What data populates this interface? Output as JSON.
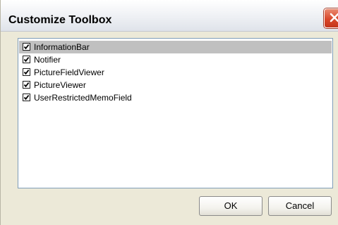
{
  "window": {
    "title": "Customize Toolbox"
  },
  "list": {
    "items": [
      {
        "label": "InformationBar",
        "checked": true,
        "selected": true
      },
      {
        "label": "Notifier",
        "checked": true,
        "selected": false
      },
      {
        "label": "PictureFieldViewer",
        "checked": true,
        "selected": false
      },
      {
        "label": "PictureViewer",
        "checked": true,
        "selected": false
      },
      {
        "label": "UserRestrictedMemoField",
        "checked": true,
        "selected": false
      }
    ]
  },
  "buttons": {
    "ok_label": "OK",
    "cancel_label": "Cancel"
  },
  "colors": {
    "close_button": "#d9472a",
    "selection": "#c0c0c0",
    "list_border": "#7f9db9"
  },
  "icons": {
    "close": "close-icon",
    "check": "checkmark-icon"
  }
}
